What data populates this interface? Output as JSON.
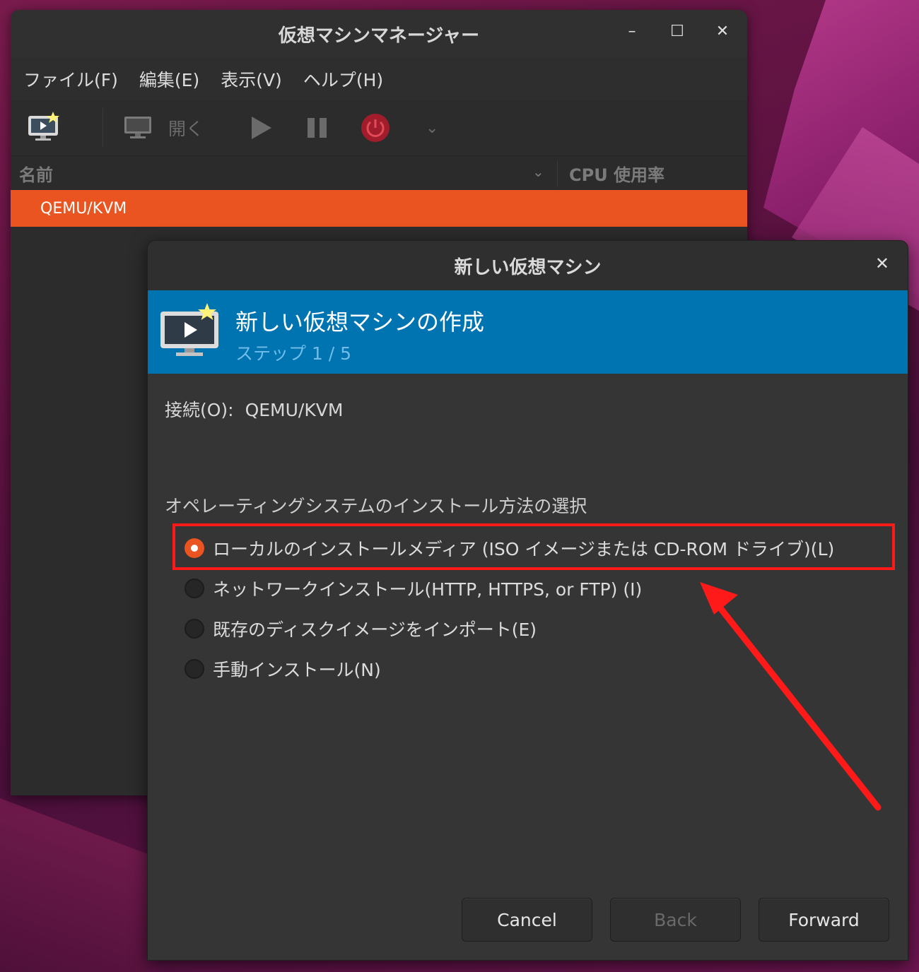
{
  "main_window": {
    "title": "仮想マシンマネージャー",
    "menus": [
      "ファイル(F)",
      "編集(E)",
      "表示(V)",
      "ヘルプ(H)"
    ],
    "toolbar": {
      "open_label": "開く"
    },
    "columns": {
      "name": "名前",
      "cpu": "CPU 使用率"
    },
    "selected_row": "QEMU/KVM"
  },
  "dialog": {
    "title": "新しい仮想マシン",
    "banner_title": "新しい仮想マシンの作成",
    "banner_step": "ステップ 1 / 5",
    "connection_label": "接続(O):",
    "connection_value": "QEMU/KVM",
    "section_label": "オペレーティングシステムのインストール方法の選択",
    "options": [
      {
        "label": "ローカルのインストールメディア (ISO イメージまたは CD-ROM ドライブ)(L)",
        "selected": true
      },
      {
        "label": "ネットワークインストール(HTTP, HTTPS, or FTP) (I)",
        "selected": false
      },
      {
        "label": "既存のディスクイメージをインポート(E)",
        "selected": false
      },
      {
        "label": "手動インストール(N)",
        "selected": false
      }
    ],
    "buttons": {
      "cancel": "Cancel",
      "back": "Back",
      "forward": "Forward"
    }
  },
  "colors": {
    "accent": "#e95420",
    "banner": "#0074b0",
    "annotation": "#ff1a1a"
  }
}
